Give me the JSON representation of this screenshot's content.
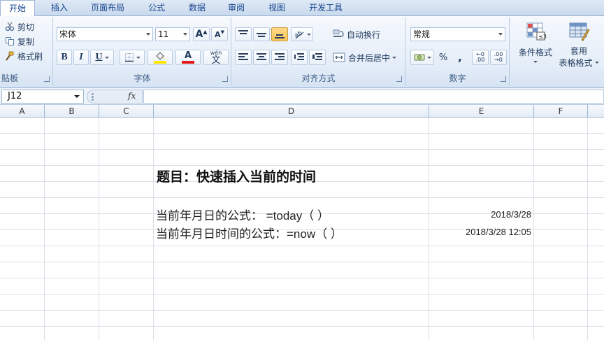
{
  "tabs": [
    {
      "label": "开始",
      "active": true
    },
    {
      "label": "插入"
    },
    {
      "label": "页面布局"
    },
    {
      "label": "公式"
    },
    {
      "label": "数据"
    },
    {
      "label": "审阅"
    },
    {
      "label": "视图"
    },
    {
      "label": "开发工具"
    }
  ],
  "clipboard": {
    "cut": "剪切",
    "copy": "复制",
    "format_painter": "格式刷",
    "group_label": "贴板"
  },
  "font": {
    "name": "宋体",
    "size": "11",
    "grow_label": "A",
    "shrink_label": "A",
    "bold": "B",
    "italic": "I",
    "underline": "U",
    "font_color_letter": "A",
    "phonetic": "wén",
    "phonetic_char": "文",
    "group_label": "字体",
    "highlight_color": "#ffe600",
    "font_color": "#e01a1a"
  },
  "alignment": {
    "wrap_text": "自动换行",
    "merge_center": "合并后居中",
    "group_label": "对齐方式"
  },
  "number": {
    "format": "常规",
    "percent": "%",
    "comma": ",",
    "inc_decimal": ".00",
    "dec_decimal": ".00",
    "group_label": "数字"
  },
  "styles": {
    "conditional_format": "条件格式",
    "table_format_line1": "套用",
    "table_format_line2": "表格格式"
  },
  "formula_bar": {
    "name_box": "J12",
    "fx": "fx",
    "formula": ""
  },
  "columns": [
    "A",
    "B",
    "C",
    "D",
    "E",
    "F"
  ],
  "sheet": {
    "title": "题目：快速插入当前的时间",
    "row1_label": "当前年月日的公式：  =today（ ）",
    "row1_value": "2018/3/28",
    "row2_label": "当前年月日时间的公式：=now（ ）",
    "row2_value": "2018/3/28 12:05"
  }
}
